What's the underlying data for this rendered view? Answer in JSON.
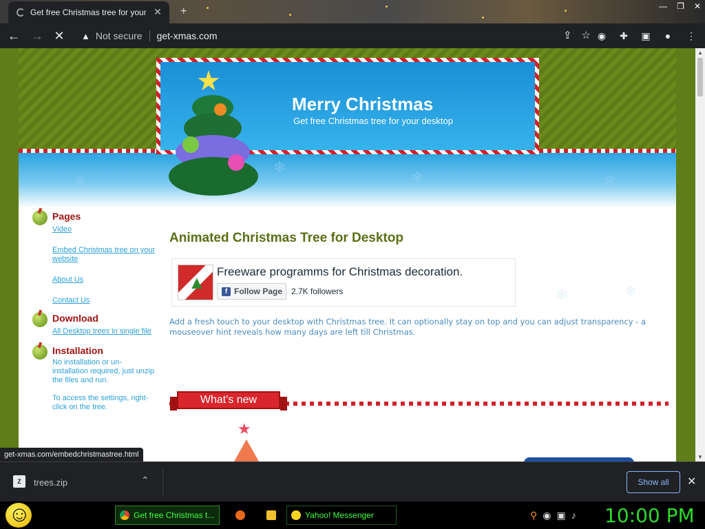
{
  "browser": {
    "tab_title": "Get free Christmas tree for your",
    "tab_close": "✕",
    "new_tab": "+",
    "not_secure": "Not secure",
    "url": "get-xmas.com",
    "status_url": "get-xmas.com/embedchristmastree.html"
  },
  "header": {
    "title": "Merry Christmas",
    "subtitle": "Get free Christmas tree for your desktop"
  },
  "sidebar": {
    "pages_heading": "Pages",
    "pages_links": [
      "Video",
      "Embed Christmas tree on your website",
      "About Us",
      "Contact Us"
    ],
    "download_heading": "Download",
    "download_link": "All Desktop trees in single file",
    "installation_heading": "Installation",
    "installation_text_1": "No installation or un-installation required, just unzip the files and run.",
    "installation_text_2": "To access the settings, right-click on the tree."
  },
  "main": {
    "title": "Animated Christmas Tree for Desktop",
    "fb_page_name": "Freeware programms for Christmas decoration.",
    "fb_follow": "Follow Page",
    "fb_followers": "2.7K followers",
    "description": "Add a fresh touch to your desktop with Christmas tree. It can optionally stay on top and you can adjust transparency - a mouseover hint reveals how many days are left till Christmas.",
    "whats_new": "What's new"
  },
  "downloads": {
    "file": "trees.zip",
    "show_all": "Show all"
  },
  "taskbar": {
    "chrome_task": "Get free Christmas t...",
    "yahoo_task": "Yahoo! Messenger",
    "clock": "10:00 PM"
  },
  "colors": {
    "page_green": "#5f7d18",
    "heading_red": "#a11313",
    "link_blue": "#2a9fd8",
    "title_olive": "#5b6f14",
    "clock_green": "#2bd92b"
  }
}
